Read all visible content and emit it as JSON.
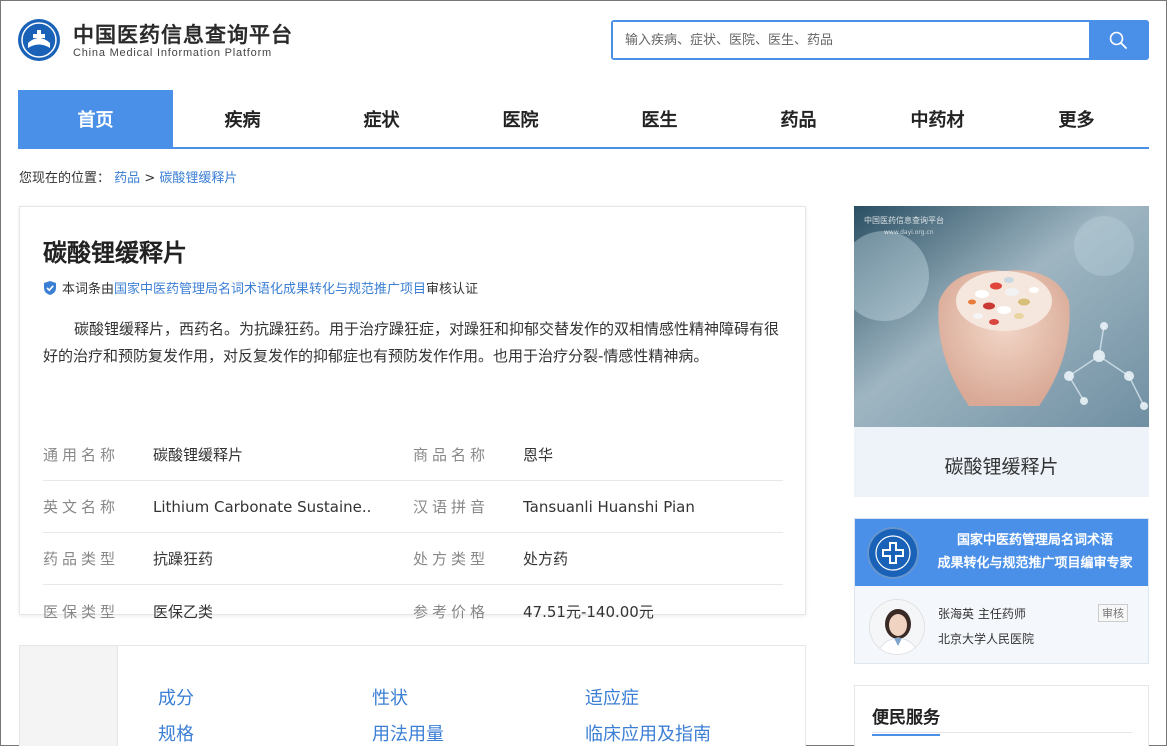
{
  "site": {
    "title": "中国医药信息查询平台",
    "subtitle": "China Medical Information Platform"
  },
  "search": {
    "placeholder": "输入疾病、症状、医院、医生、药品"
  },
  "nav": {
    "items": [
      {
        "label": "首页",
        "active": true
      },
      {
        "label": "疾病"
      },
      {
        "label": "症状"
      },
      {
        "label": "医院"
      },
      {
        "label": "医生"
      },
      {
        "label": "药品"
      },
      {
        "label": "中药材"
      },
      {
        "label": "更多"
      }
    ]
  },
  "breadcrumb": {
    "prefix": "您现在的位置：",
    "level1": "药品",
    "separator": ">",
    "level2": "碳酸锂缓释片"
  },
  "drug": {
    "name": "碳酸锂缓释片",
    "cert_prefix": "本词条由",
    "cert_org": "国家中医药管理局名词术语化成果转化与规范推广项目",
    "cert_suffix": "审核认证",
    "description": "碳酸锂缓释片，西药名。为抗躁狂药。用于治疗躁狂症，对躁狂和抑郁交替发作的双相情感性精神障碍有很好的治疗和预防复发作用，对反复发作的抑郁症也有预防发作作用。也用于治疗分裂-情感性精神病。",
    "info": [
      {
        "l1": "通用名称",
        "v1": "碳酸锂缓释片",
        "l2": "商品名称",
        "v2": "恩华"
      },
      {
        "l1": "英文名称",
        "v1": "Lithium Carbonate Sustaine..",
        "l2": "汉语拼音",
        "v2": "Tansuanli Huanshi Pian"
      },
      {
        "l1": "药品类型",
        "v1": "抗躁狂药",
        "l2": "处方类型",
        "v2": "处方药"
      },
      {
        "l1": "医保类型",
        "v1": "医保乙类",
        "l2": "参考价格",
        "v2": "47.51元-140.00元"
      }
    ]
  },
  "sections": {
    "links": [
      "成分",
      "性状",
      "适应症",
      "规格",
      "用法用量",
      "临床应用及指南"
    ]
  },
  "sidebar": {
    "image_name": "碳酸锂缓释片",
    "watermark": "中国医药信息查询平台",
    "watermark_url": "www.dayi.org.cn",
    "banner_line1": "国家中医药管理局名词术语",
    "banner_line2": "成果转化与规范推广项目编审专家",
    "expert_name": "张海英  主任药师",
    "expert_hospital": "北京大学人民医院",
    "expert_badge": "审核",
    "service_title": "便民服务"
  },
  "colors": {
    "accent": "#4a90e8",
    "link": "#3b7fd4",
    "logo": "#1a62b8"
  }
}
